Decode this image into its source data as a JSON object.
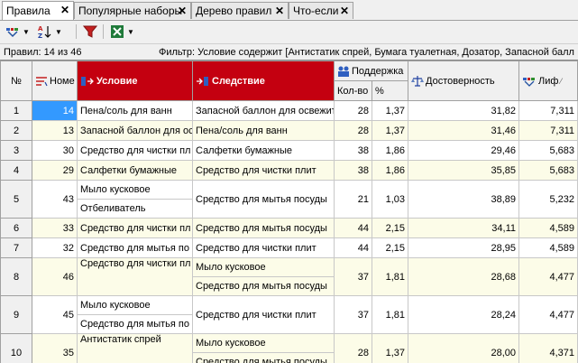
{
  "tabs": [
    {
      "label": "Правила",
      "active": true
    },
    {
      "label": "Популярные наборы",
      "active": false
    },
    {
      "label": "Дерево правил",
      "active": false
    },
    {
      "label": "Что-если",
      "active": false
    }
  ],
  "toolbar": {
    "icons": [
      "rule-filter-icon",
      "sort-az-icon",
      "filter-icon",
      "excel-export-icon"
    ]
  },
  "info": {
    "count": "Правил: 14 из 46",
    "filter": "Фильтр: Условие содержит [Антистатик спрей, Бумага туалетная, Дозатор, Запасной балл"
  },
  "grid": {
    "headers": {
      "index": "№",
      "number": "Номе",
      "condition": "Условие",
      "consequence": "Следствие",
      "support": "Поддержка",
      "support_count": "Кол-во",
      "support_pct": "%",
      "confidence": "Достоверность",
      "lift": "Лиф"
    },
    "rows": [
      {
        "idx": "1",
        "num": "14",
        "cond": [
          "Пена/соль для ванн"
        ],
        "cons": [
          "Запасной баллон для освежит"
        ],
        "cnt": "28",
        "pct": "1,37",
        "conf": "31,82",
        "lift": "7,311"
      },
      {
        "idx": "2",
        "num": "13",
        "cond": [
          "Запасной баллон для ос"
        ],
        "cons": [
          "Пена/соль для ванн"
        ],
        "cnt": "28",
        "pct": "1,37",
        "conf": "31,46",
        "lift": "7,311"
      },
      {
        "idx": "3",
        "num": "30",
        "cond": [
          "Средство для чистки пл"
        ],
        "cons": [
          "Салфетки бумажные"
        ],
        "cnt": "38",
        "pct": "1,86",
        "conf": "29,46",
        "lift": "5,683"
      },
      {
        "idx": "4",
        "num": "29",
        "cond": [
          "Салфетки бумажные"
        ],
        "cons": [
          "Средство для чистки плит"
        ],
        "cnt": "38",
        "pct": "1,86",
        "conf": "35,85",
        "lift": "5,683"
      },
      {
        "idx": "5",
        "num": "43",
        "cond": [
          "Мыло кусковое",
          "Отбеливатель"
        ],
        "cons": [
          "Средство для мытья посуды"
        ],
        "cnt": "21",
        "pct": "1,03",
        "conf": "38,89",
        "lift": "5,232"
      },
      {
        "idx": "6",
        "num": "33",
        "cond": [
          "Средство для чистки пл"
        ],
        "cons": [
          "Средство для мытья посуды"
        ],
        "cnt": "44",
        "pct": "2,15",
        "conf": "34,11",
        "lift": "4,589"
      },
      {
        "idx": "7",
        "num": "32",
        "cond": [
          "Средство для мытья по"
        ],
        "cons": [
          "Средство для чистки плит"
        ],
        "cnt": "44",
        "pct": "2,15",
        "conf": "28,95",
        "lift": "4,589"
      },
      {
        "idx": "8",
        "num": "46",
        "cond": [
          "Средство для чистки пл"
        ],
        "cons": [
          "Мыло кусковое",
          "Средство для мытья посуды"
        ],
        "cnt": "37",
        "pct": "1,81",
        "conf": "28,68",
        "lift": "4,477"
      },
      {
        "idx": "9",
        "num": "45",
        "cond": [
          "Мыло кусковое",
          "Средство для мытья по"
        ],
        "cons": [
          "Средство для чистки плит"
        ],
        "cnt": "37",
        "pct": "1,81",
        "conf": "28,24",
        "lift": "4,477"
      },
      {
        "idx": "10",
        "num": "35",
        "cond": [
          "Антистатик спрей"
        ],
        "cons": [
          "Мыло кусковое",
          "Средство для мытья посуды"
        ],
        "cnt": "28",
        "pct": "1,37",
        "conf": "28,00",
        "lift": "4,371"
      }
    ]
  }
}
